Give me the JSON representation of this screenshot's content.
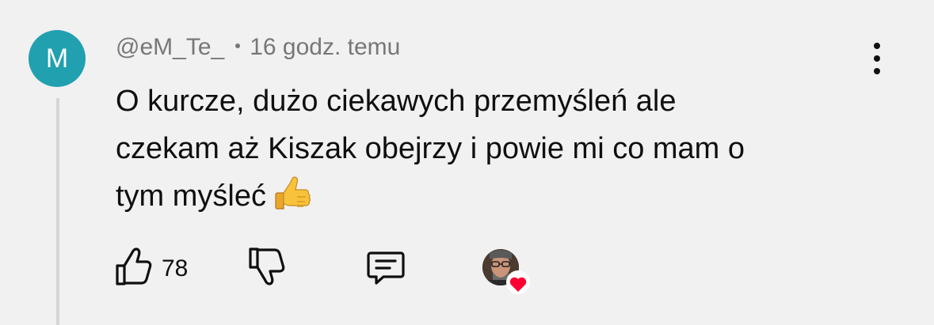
{
  "comment": {
    "avatar_letter": "M",
    "avatar_color": "#21a0b0",
    "author": "@eM_Te_",
    "time": "16 godz. temu",
    "text_lines": [
      "O kurcze, dużo ciekawych przemyśleń ale",
      "czekam aż Kiszak obejrzy i powie mi co mam o",
      "tym myśleć"
    ],
    "emoji": "thumbs-up-emoji"
  },
  "actions": {
    "like_count": "78",
    "like_icon": "thumbs-up-icon",
    "dislike_icon": "thumbs-down-icon",
    "reply_icon": "comment-icon",
    "creator_heart_icon": "creator-heart-badge",
    "heart_color": "#ff0033"
  }
}
